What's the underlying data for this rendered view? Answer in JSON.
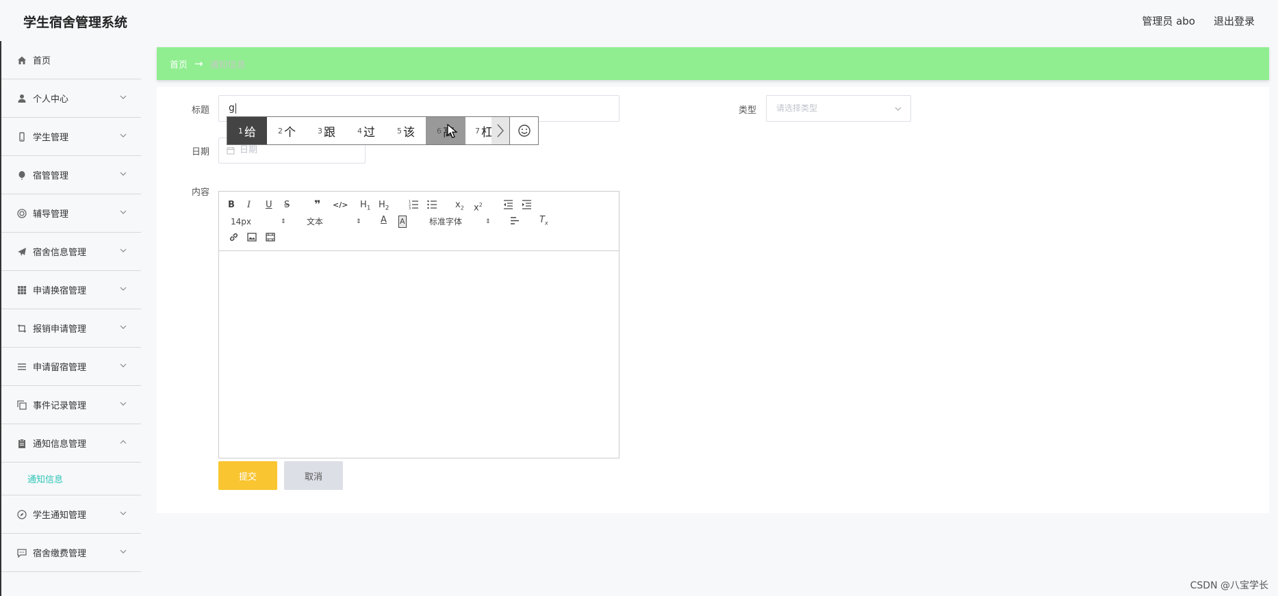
{
  "app": {
    "title": "学生宿舍管理系统",
    "admin_label": "管理员 abo",
    "logout_label": "退出登录"
  },
  "sidebar": {
    "items": [
      {
        "label": "首页",
        "icon": "home-icon"
      },
      {
        "label": "个人中心",
        "icon": "user-icon"
      },
      {
        "label": "学生管理",
        "icon": "mobile-icon"
      },
      {
        "label": "宿管管理",
        "icon": "balloon-icon"
      },
      {
        "label": "辅导管理",
        "icon": "life-ring-icon"
      },
      {
        "label": "宿舍信息管理",
        "icon": "paper-plane-icon"
      },
      {
        "label": "申请换宿管理",
        "icon": "grid-icon"
      },
      {
        "label": "报销申请管理",
        "icon": "crop-icon"
      },
      {
        "label": "申请留宿管理",
        "icon": "list-icon"
      },
      {
        "label": "事件记录管理",
        "icon": "copy-icon"
      },
      {
        "label": "通知信息管理",
        "icon": "clipboard-icon",
        "expanded": true
      },
      {
        "label": "学生通知管理",
        "icon": "compass-icon"
      },
      {
        "label": "宿舍缴费管理",
        "icon": "comment-icon"
      }
    ],
    "sub_item": {
      "label": "通知信息",
      "color": "#2ec4b6"
    }
  },
  "breadcrumb": {
    "home": "首页",
    "arrow": "→",
    "current": "通知信息",
    "bg_color": "#90ee90"
  },
  "form": {
    "title_label": "标题",
    "title_value": "g",
    "type_label": "类型",
    "type_placeholder": "请选择类型",
    "date_label": "日期",
    "date_placeholder": "日期",
    "content_label": "内容",
    "editor": {
      "font_size": "14px",
      "text_style": "文本",
      "font_family": "标准字体"
    },
    "submit_label": "提交",
    "cancel_label": "取消",
    "submit_color": "#f9c531"
  },
  "ime": {
    "candidates": [
      {
        "num": "1",
        "text": "给"
      },
      {
        "num": "2",
        "text": "个"
      },
      {
        "num": "3",
        "text": "跟"
      },
      {
        "num": "4",
        "text": "过"
      },
      {
        "num": "5",
        "text": "该"
      },
      {
        "num": "6",
        "text": "高"
      },
      {
        "num": "7",
        "text": "杠"
      }
    ]
  },
  "watermark": "CSDN @八宝学长"
}
